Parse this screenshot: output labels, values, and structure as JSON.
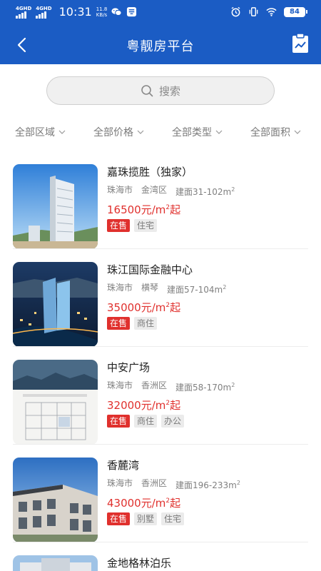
{
  "status": {
    "signal1": "4GHD",
    "signal2": "4GHD",
    "time": "10:31",
    "speed_value": "11.8",
    "speed_unit": "KB/s",
    "battery": "84"
  },
  "header": {
    "back_icon": "chevron-left-icon",
    "title": "粤靓房平台",
    "action_icon": "clipboard-chart-icon"
  },
  "search": {
    "placeholder": "搜索",
    "icon": "search-icon"
  },
  "filters": [
    {
      "label": "全部区域"
    },
    {
      "label": "全部价格"
    },
    {
      "label": "全部类型"
    },
    {
      "label": "全部面积"
    }
  ],
  "listings": [
    {
      "name": "嘉珠揽胜（独家）",
      "city": "珠海市",
      "district": "金湾区",
      "area_prefix": "建面31-102m",
      "area_unit_sup": "2",
      "price_prefix": "16500元/m",
      "price_sup": "2",
      "price_suffix": "起",
      "status": "在售",
      "types": [
        "住宅"
      ]
    },
    {
      "name": "珠江国际金融中心",
      "city": "珠海市",
      "district": "横琴",
      "area_prefix": "建面57-104m",
      "area_unit_sup": "2",
      "price_prefix": "35000元/m",
      "price_sup": "2",
      "price_suffix": "起",
      "status": "在售",
      "types": [
        "商住"
      ]
    },
    {
      "name": "中安广场",
      "city": "珠海市",
      "district": "香洲区",
      "area_prefix": "建面58-170m",
      "area_unit_sup": "2",
      "price_prefix": "32000元/m",
      "price_sup": "2",
      "price_suffix": "起",
      "status": "在售",
      "types": [
        "商住",
        "办公"
      ]
    },
    {
      "name": "香麓湾",
      "city": "珠海市",
      "district": "香洲区",
      "area_prefix": "建面196-233m",
      "area_unit_sup": "2",
      "price_prefix": "43000元/m",
      "price_sup": "2",
      "price_suffix": "起",
      "status": "在售",
      "types": [
        "别墅",
        "住宅"
      ]
    },
    {
      "name": "金地格林泊乐"
    }
  ]
}
